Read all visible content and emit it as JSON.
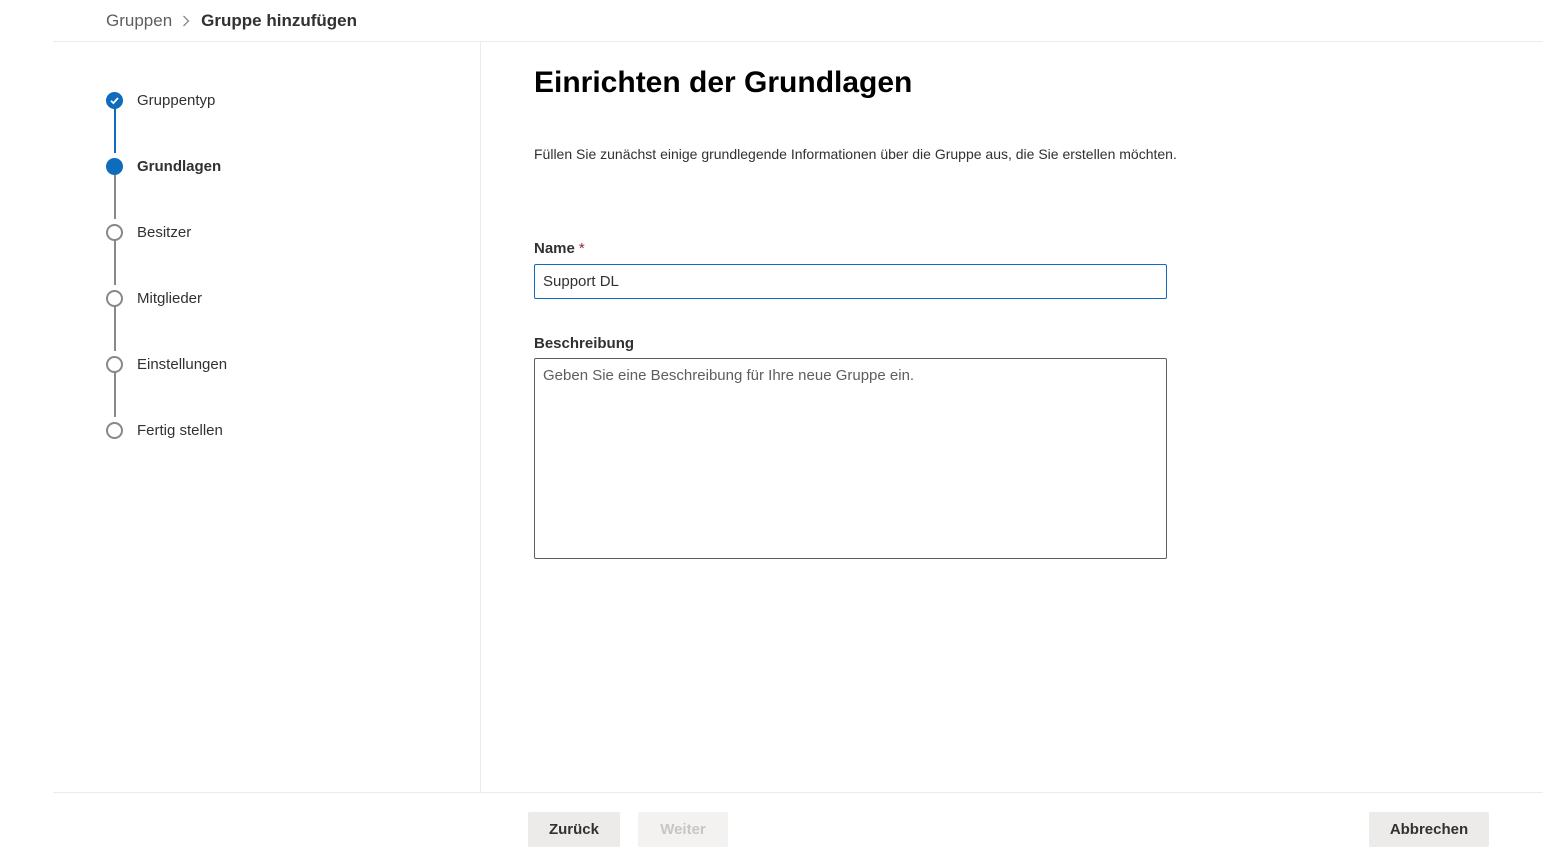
{
  "breadcrumb": {
    "parent": "Gruppen",
    "current": "Gruppe hinzufügen"
  },
  "steps": [
    {
      "label": "Gruppentyp",
      "state": "done"
    },
    {
      "label": "Grundlagen",
      "state": "current"
    },
    {
      "label": "Besitzer",
      "state": "pending"
    },
    {
      "label": "Mitglieder",
      "state": "pending"
    },
    {
      "label": "Einstellungen",
      "state": "pending"
    },
    {
      "label": "Fertig stellen",
      "state": "pending"
    }
  ],
  "main": {
    "title": "Einrichten der Grundlagen",
    "description": "Füllen Sie zunächst einige grundlegende Informationen über die Gruppe aus, die Sie erstellen möchten.",
    "name_label": "Name",
    "required_mark": "*",
    "name_value": "Support DL",
    "description_label": "Beschreibung",
    "description_placeholder": "Geben Sie eine Beschreibung für Ihre neue Gruppe ein."
  },
  "footer": {
    "back_label": "Zurück",
    "next_label": "Weiter",
    "cancel_label": "Abbrechen"
  },
  "colors": {
    "accent": "#0f6cbd",
    "required": "#a4262c",
    "step_pending": "#8a8886"
  },
  "icons": {
    "breadcrumb_separator": "chevron-right-icon",
    "step_done": "checkmark-icon"
  }
}
